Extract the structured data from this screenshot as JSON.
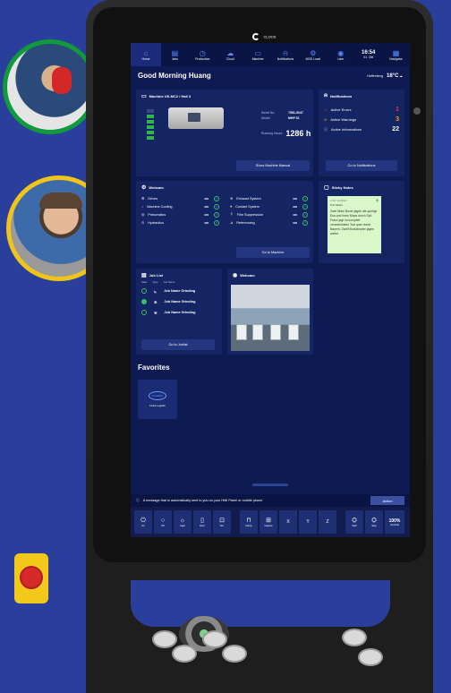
{
  "brand": {
    "name": "CLOOS"
  },
  "nav": {
    "items": [
      {
        "label": "Home",
        "icon": "home-icon"
      },
      {
        "label": "Jobs",
        "icon": "jobs-icon"
      },
      {
        "label": "Production",
        "icon": "production-icon"
      },
      {
        "label": "Cloud",
        "icon": "cloud-icon"
      },
      {
        "label": "Machine",
        "icon": "machine-icon"
      },
      {
        "label": "Notifications",
        "icon": "bell-icon"
      },
      {
        "label": "MSS Local",
        "icon": "settings-icon"
      },
      {
        "label": "User",
        "icon": "user-icon"
      }
    ],
    "time": "16:54",
    "date": "01. Okt",
    "navigator_label": "Navigator"
  },
  "greeting": "Good Morning Huang",
  "weather": {
    "location": "Hoffenberg",
    "temp": "18°C"
  },
  "machine": {
    "title": "Machine US-MC2 / Hall 3",
    "serial_label": "Serial No.",
    "serial": "7951-0047",
    "model_label": "Model",
    "model": "MHP 51",
    "hours_label": "Running Hours",
    "hours": "1286 h",
    "manual_button": "Show Machine Manual"
  },
  "notifications": {
    "title": "Notifications",
    "rows": [
      {
        "label": "Active Errors",
        "count": "1",
        "color": "#e53935"
      },
      {
        "label": "Active Warnings",
        "count": "3",
        "color": "#f4a400"
      },
      {
        "label": "Active Informations",
        "count": "22",
        "color": "#ffffff"
      }
    ],
    "button": "Go to Notifications"
  },
  "status": {
    "title": "Webcam",
    "items": [
      {
        "name": "Drives",
        "value": "on"
      },
      {
        "name": "Exhaust System",
        "value": "on"
      },
      {
        "name": "Machine Cooling",
        "value": "on"
      },
      {
        "name": "Coolant System",
        "value": "on"
      },
      {
        "name": "Pneumatics",
        "value": "on"
      },
      {
        "name": "Film Suppression",
        "value": "on"
      },
      {
        "name": "Hydraulics",
        "value": "on"
      },
      {
        "name": "Referencing",
        "value": "on"
      }
    ],
    "button": "Go to Machine"
  },
  "sticky": {
    "title": "Sticky Notes",
    "note_date": "17.07. 10:43:21",
    "note_author": "Fritz Müller",
    "note_text": "Zwei flinke Boxer jagen die quirlige Eva und ihren Mops durch Sylt. Franz jagt im komplett verwahrlosten Taxi quer durch Bayern. Zwölf Boxkämpfer jagen weiter."
  },
  "jobs": {
    "title": "Job List",
    "headers": [
      "State",
      "Type",
      "Job Name"
    ],
    "rows": [
      {
        "name": "Job Name Grinding",
        "active": false
      },
      {
        "name": "Job Name Grinding",
        "active": true
      },
      {
        "name": "Job Name Grinding",
        "active": false
      }
    ],
    "button": "Go to Joblist"
  },
  "webcam": {
    "title": "Webcam"
  },
  "favorites": {
    "title": "Favorites",
    "tiles": [
      {
        "logo": "CLASSIC",
        "label": "Fluid Logistic"
      }
    ]
  },
  "message": {
    "text": "A message that is automatically sent to you on your HMI Panel or mobile phone",
    "action": "Action"
  },
  "bottom_bar": {
    "buttons": [
      {
        "label": "On",
        "icon": "power-icon"
      },
      {
        "label": "Off",
        "icon": "circle-icon"
      },
      {
        "label": "Light",
        "icon": "light-icon"
      },
      {
        "label": "Door",
        "icon": "door-icon"
      },
      {
        "label": "Sel.",
        "icon": "select-icon"
      },
      {
        "label": "Clamp",
        "icon": "clamp-icon"
      },
      {
        "label": "Capture",
        "icon": "capture-icon"
      }
    ],
    "axes": [
      "X",
      "Y",
      "Z"
    ],
    "controls": [
      {
        "label": "Start",
        "icon": "start-icon"
      },
      {
        "label": "Stop",
        "icon": "stop-icon"
      }
    ],
    "override_value": "100%",
    "override_label": "Override"
  }
}
